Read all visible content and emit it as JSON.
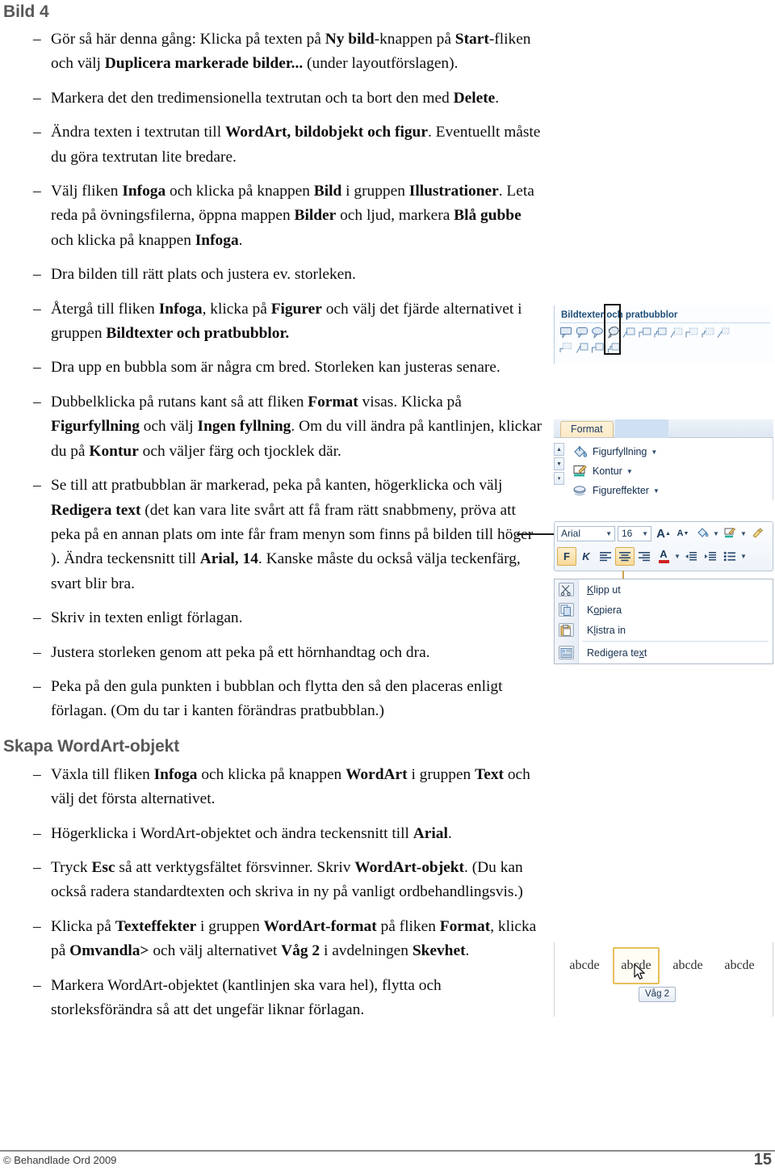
{
  "document": {
    "heading_bild": "Bild 4",
    "heading_wordart": "Skapa WordArt-objekt",
    "footer_copyright": "© Behandlade Ord 2009",
    "page_number": "15"
  },
  "colors": {
    "heading_gray": "#58585a",
    "body_black": "#100d0c",
    "ribbon_blue": "#1f4e79",
    "selection_gold": "#e8c05a"
  },
  "bullets_section1": [
    {
      "id": "b1",
      "html": "Gör så här denna gång: Klicka på texten på <b>Ny bild</b>-knappen på <b>Start</b>-fliken och välj <b>Duplicera markerade bilder...</b> (under layoutförslagen)."
    },
    {
      "id": "b2",
      "html": "Markera det den tredimensionella textrutan och ta bort den med <b>Delete</b>."
    },
    {
      "id": "b3",
      "html": "Ändra texten i textrutan till <b>WordArt, bildobjekt och figur</b>. Eventuellt måste du göra textrutan lite bredare."
    },
    {
      "id": "b4",
      "html": "Välj fliken <b>Infoga</b> och klicka på knappen <b>Bild</b> i gruppen <b>Illustrationer</b>. Leta reda på övningsfilerna, öppna mappen <b>Bilder</b> och ljud, markera <b>Blå gubbe</b> och klicka på knappen <b>Infoga</b>."
    },
    {
      "id": "b5",
      "html": "Dra bilden till rätt plats och justera ev. storleken."
    },
    {
      "id": "b6",
      "html": "Återgå till fliken <b>Infoga</b>, klicka på <b>Figurer</b> och välj det fjärde alternativet i gruppen <b>Bildtexter och pratbubblor.</b>"
    },
    {
      "id": "b7",
      "html": "Dra upp en bubbla som är några cm bred. Storleken kan justeras senare."
    },
    {
      "id": "b8",
      "html": "Dubbelklicka på rutans kant så att fliken <b>Format</b> visas. Klicka på <b>Figurfyllning</b> och välj <b>Ingen fyllning</b>. Om du vill ändra på kantlinjen, klickar du på <b>Kontur</b> och väljer färg och tjocklek där."
    },
    {
      "id": "b9",
      "html": "Se till att pratbubblan är markerad, peka på kanten, högerklicka och välj <b>Redigera text</b> (det kan vara lite svårt att få fram rätt snabbmeny, pröva att peka på en annan plats om inte får fram menyn som finns på bilden till höger ). Ändra teckensnitt till <b>Arial, 14</b>. Kanske måste du också välja teckenfärg, svart blir bra."
    },
    {
      "id": "b10",
      "html": "Skriv in texten enligt förlagan."
    },
    {
      "id": "b11",
      "html": "Justera storleken genom att peka på ett hörnhandtag och dra."
    },
    {
      "id": "b12",
      "html": "Peka på den gula punkten i bubblan och flytta den så den placeras enligt förlagan. (Om du tar i kanten förändras pratbubblan.)"
    }
  ],
  "bullets_section2": [
    {
      "id": "c1",
      "html": "Växla till fliken <b>Infoga</b> och klicka på knappen <b>WordArt</b> i gruppen <b>Text</b> och välj det första alternativet."
    },
    {
      "id": "c2",
      "html": "Högerklicka i WordArt-objektet och ändra teckensnitt till <b>Arial</b>."
    },
    {
      "id": "c3",
      "html": "Tryck <b>Esc</b> så att verktygsfältet försvinner. Skriv <b>WordArt-objekt</b>. (Du kan också radera standardtexten och skriva in ny på vanligt ordbehandlingsvis.)"
    },
    {
      "id": "c4",
      "html": "Klicka på <b>Texteffekter</b> i gruppen <b>WordArt-format</b> på fliken <b>Format</b>, klicka på <b>Omvandla&gt;</b> och välj alternativet <b>Våg 2</b> i avdelningen <b>Skevhet</b>."
    },
    {
      "id": "c5",
      "html": "Markera WordArt-objektet (kantlinjen ska vara hel), flytta och storleksförändra så att det ungefär liknar förlagan."
    }
  ],
  "screenshot_callouts": {
    "group_title": "Bildtexter och pratbubblor",
    "selected_index": 3,
    "row1_count": 11,
    "row2_count": 4
  },
  "screenshot_format": {
    "tab_label": "Format",
    "items": [
      {
        "label": "Figurfyllning",
        "icon": "paint-bucket-icon"
      },
      {
        "label": "Kontur",
        "icon": "shape-outline-icon"
      },
      {
        "label": "Figureffekter",
        "icon": "shape-effects-icon"
      }
    ]
  },
  "screenshot_minitoolbar": {
    "font_name": "Arial",
    "font_size": "16",
    "buttons_row1": [
      "grow-font-icon",
      "shrink-font-icon",
      "text-highlight-icon",
      "font-color-picker-icon",
      "format-painter-icon"
    ],
    "bold_label": "F",
    "italic_label": "K",
    "align_buttons": [
      "align-left-icon",
      "align-center-icon",
      "align-right-icon"
    ],
    "font_color_label": "A",
    "active_align_index": 1,
    "bold_active": true
  },
  "screenshot_contextmenu": {
    "items": [
      {
        "label": "Klipp ut",
        "accel": "K",
        "icon": "scissors-icon"
      },
      {
        "label": "Kopiera",
        "accel": "o",
        "icon": "copy-icon"
      },
      {
        "label": "Klistra in",
        "accel": "l",
        "icon": "paste-icon"
      },
      {
        "label": "Redigera text",
        "accel": "x",
        "icon": "edit-text-icon"
      }
    ]
  },
  "screenshot_wordart": {
    "samples": [
      "abcde",
      "abcde",
      "abcde",
      "abcde"
    ],
    "selected_index": 1,
    "tooltip": "Våg 2"
  }
}
